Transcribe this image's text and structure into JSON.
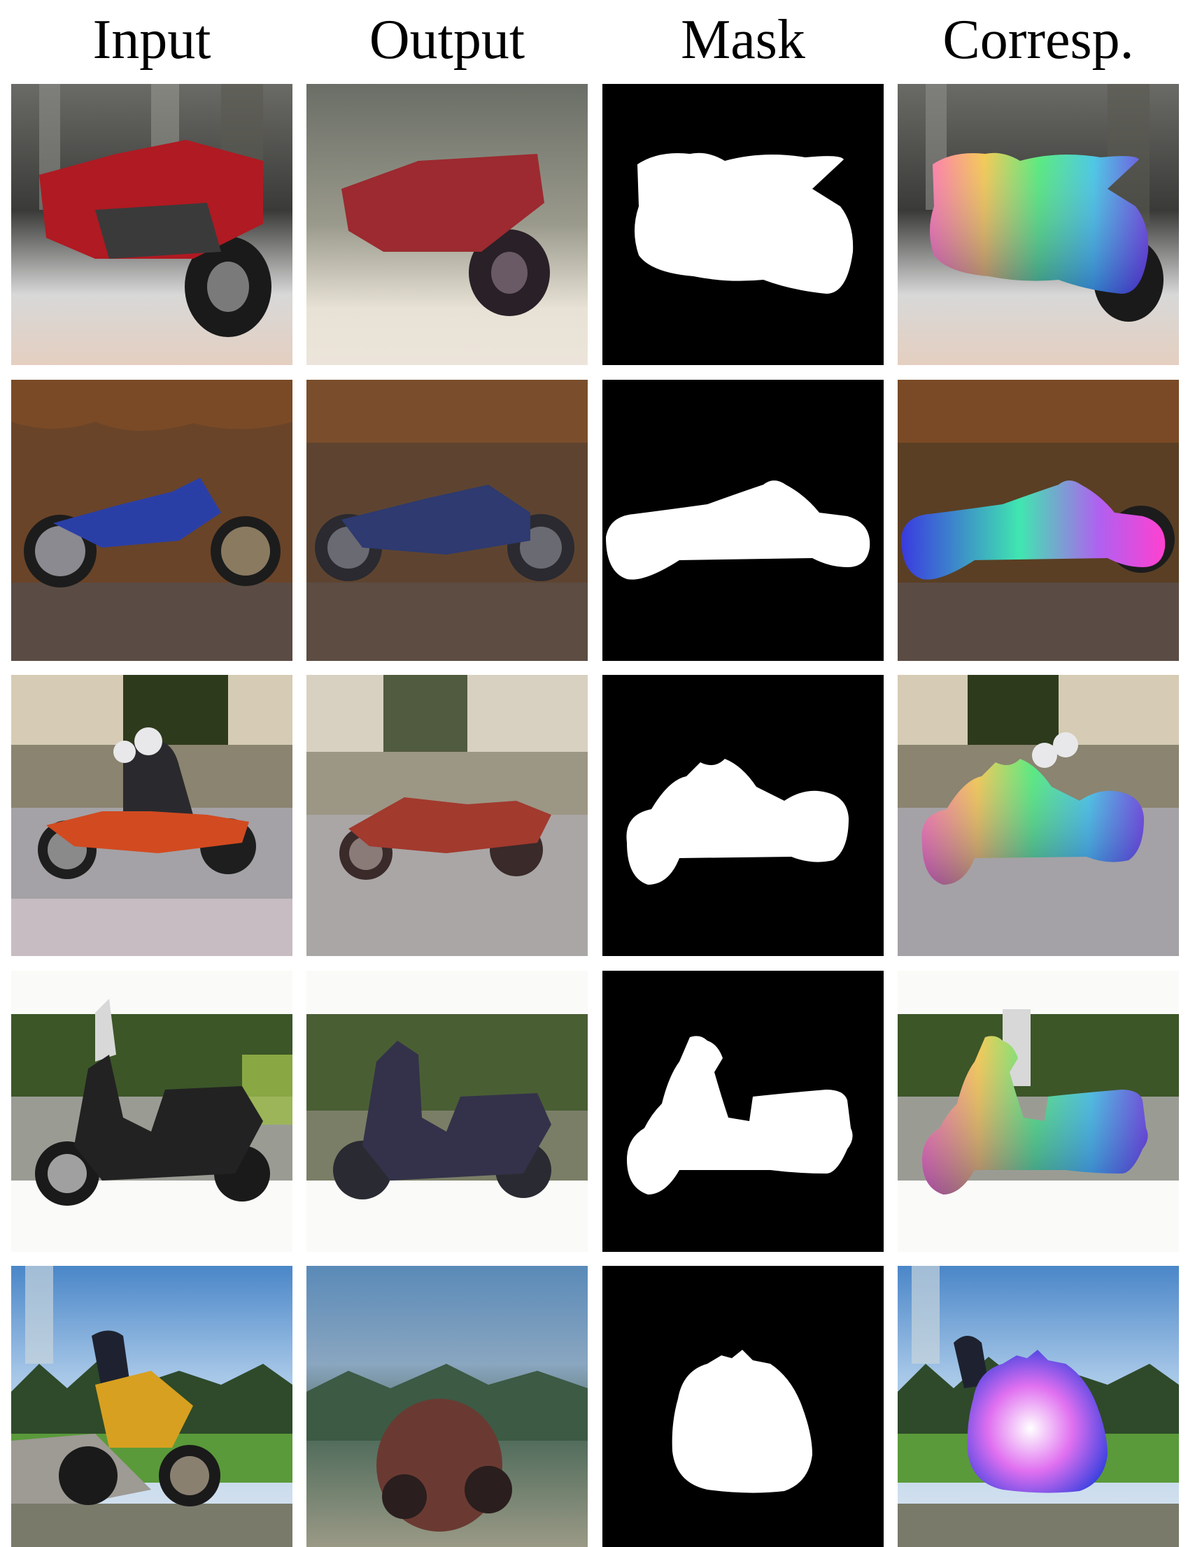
{
  "headers": {
    "input": "Input",
    "output": "Output",
    "mask": "Mask",
    "corresp": "Corresp."
  },
  "rows": [
    {
      "id": "red-sportbike",
      "bike_color": "#b01a22",
      "bg_top": "#4a4a46",
      "bg_bottom": "#d8c8b8"
    },
    {
      "id": "blue-chopper",
      "bike_color": "#2a3fa6",
      "bg_top": "#6e4a2a",
      "bg_bottom": "#5a4a40"
    },
    {
      "id": "orange-cruiser-riders",
      "bike_color": "#d24a20",
      "bg_top": "#9a8e70",
      "bg_bottom": "#bdb4b8"
    },
    {
      "id": "black-scooter",
      "bike_color": "#222222",
      "bg_top": "#3f5a2a",
      "bg_bottom": "#e8e8e4"
    },
    {
      "id": "yellow-adventure-bike",
      "bike_color": "#d8a020",
      "bg_top": "#6a9ad0",
      "bg_bottom": "#7a8a6a"
    }
  ]
}
